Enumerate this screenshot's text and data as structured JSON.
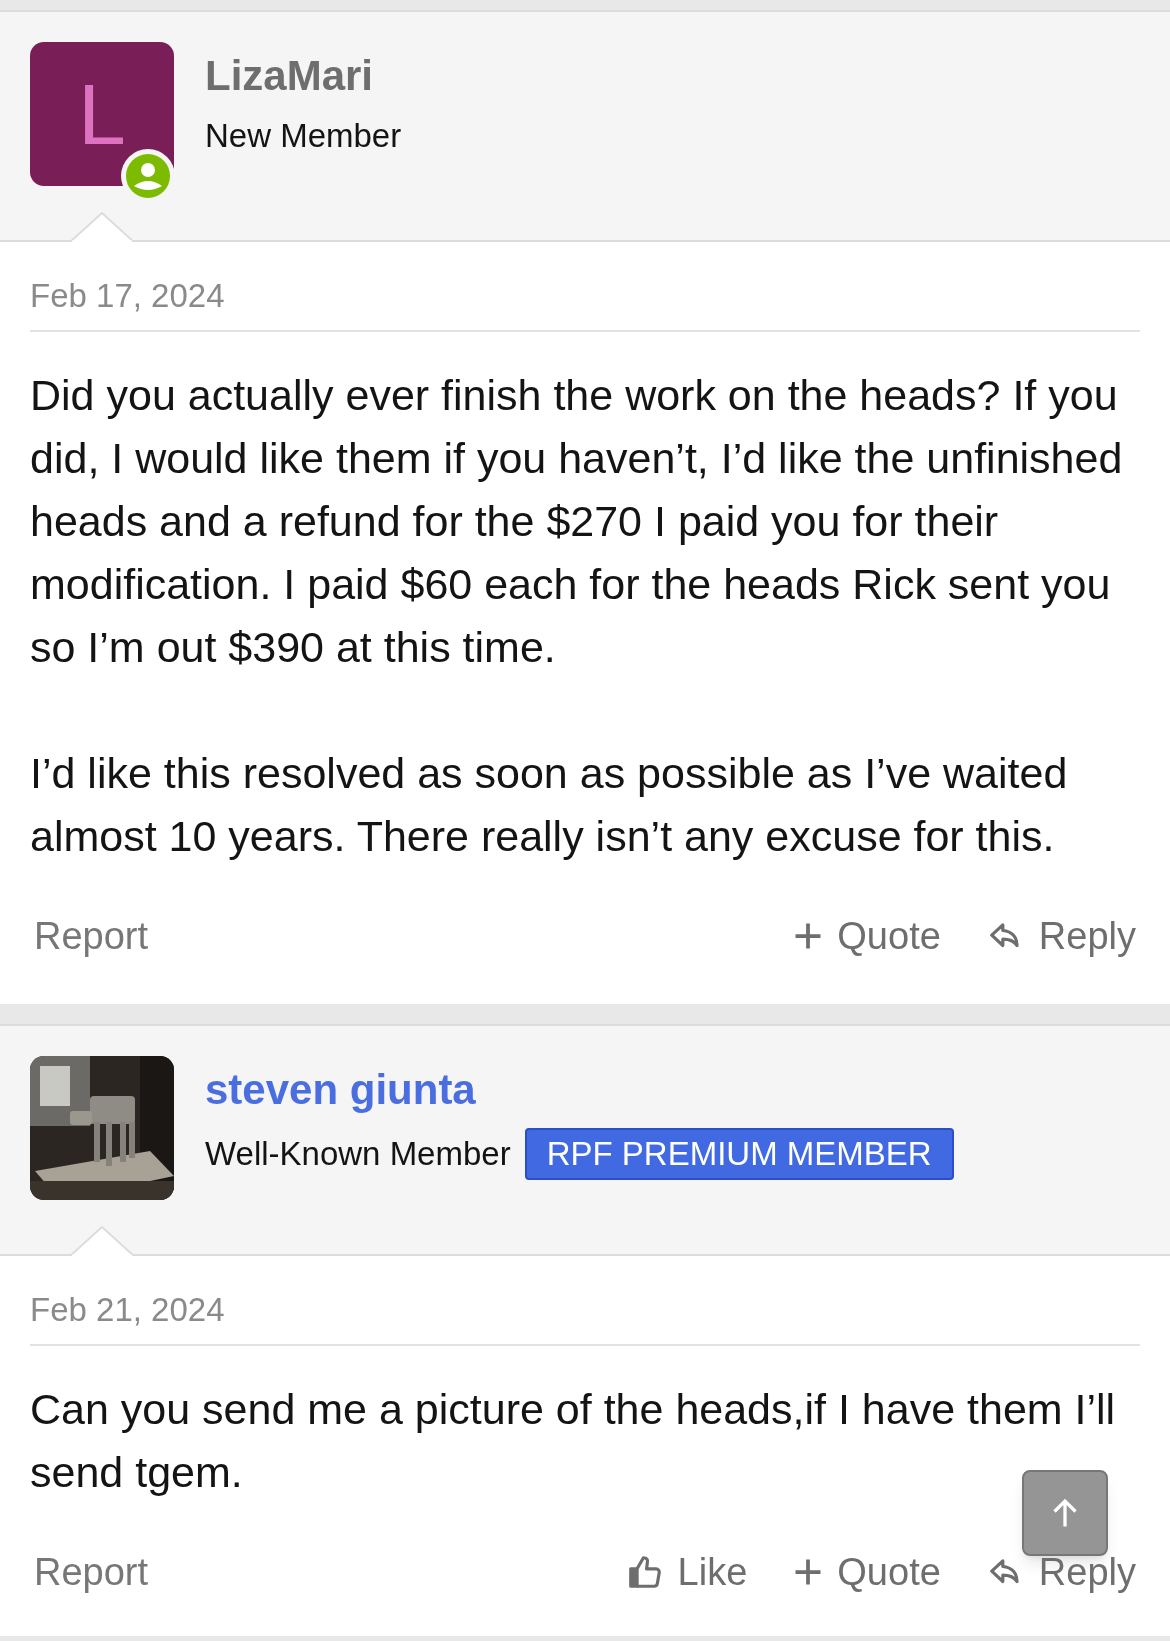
{
  "posts": [
    {
      "author": {
        "name": "LizaMari",
        "color": "#6e6e6e",
        "title": "New Member",
        "online": true,
        "avatar": {
          "kind": "letter",
          "letter": "L",
          "color": "#7a1e58"
        }
      },
      "date": "Feb 17, 2024",
      "paragraphs": [
        "Did you actually ever finish the work on the heads? If you did, I would like them if you haven’t, I’d like the unfinished heads and a refund for the $270 I paid you for their modification. I paid $60 each for the heads Rick sent you so I’m out $390 at this time.",
        "I’d like this resolved as soon as possible as I’ve waited almost 10 years. There really isn’t any excuse for this."
      ],
      "actions": [
        {
          "kind": "report",
          "label": "Report"
        },
        {
          "kind": "quote",
          "label": "Quote"
        },
        {
          "kind": "reply",
          "label": "Reply"
        }
      ]
    },
    {
      "author": {
        "name": "steven giunta",
        "color": "#4a6ee0",
        "title": "Well-Known Member",
        "badge": "RPF PREMIUM MEMBER",
        "online": false
      },
      "date": "Feb 21, 2024",
      "paragraphs": [
        "Can you send me a picture of the heads,if I have them I’ll send tgem."
      ],
      "actions": [
        {
          "kind": "report",
          "label": "Report"
        },
        {
          "kind": "like",
          "label": "Like"
        },
        {
          "kind": "quote",
          "label": "Quote"
        },
        {
          "kind": "reply",
          "label": "Reply"
        }
      ]
    }
  ]
}
